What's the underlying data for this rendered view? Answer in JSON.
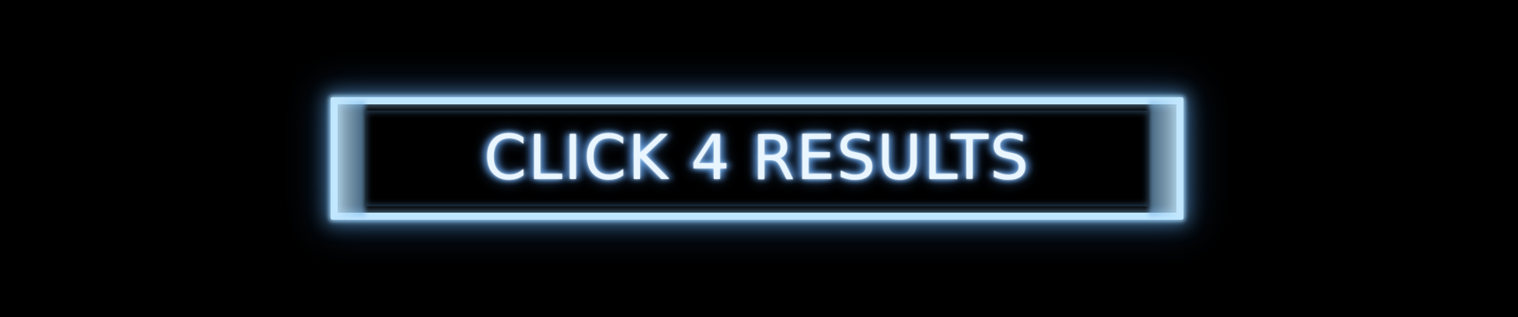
{
  "button": {
    "label": "CLICK 4 RESULTS"
  },
  "colors": {
    "background": "#000000",
    "neon_frame": "#bfe6ff",
    "glow": "#6eb4f0",
    "text": "#eaf6ff"
  }
}
